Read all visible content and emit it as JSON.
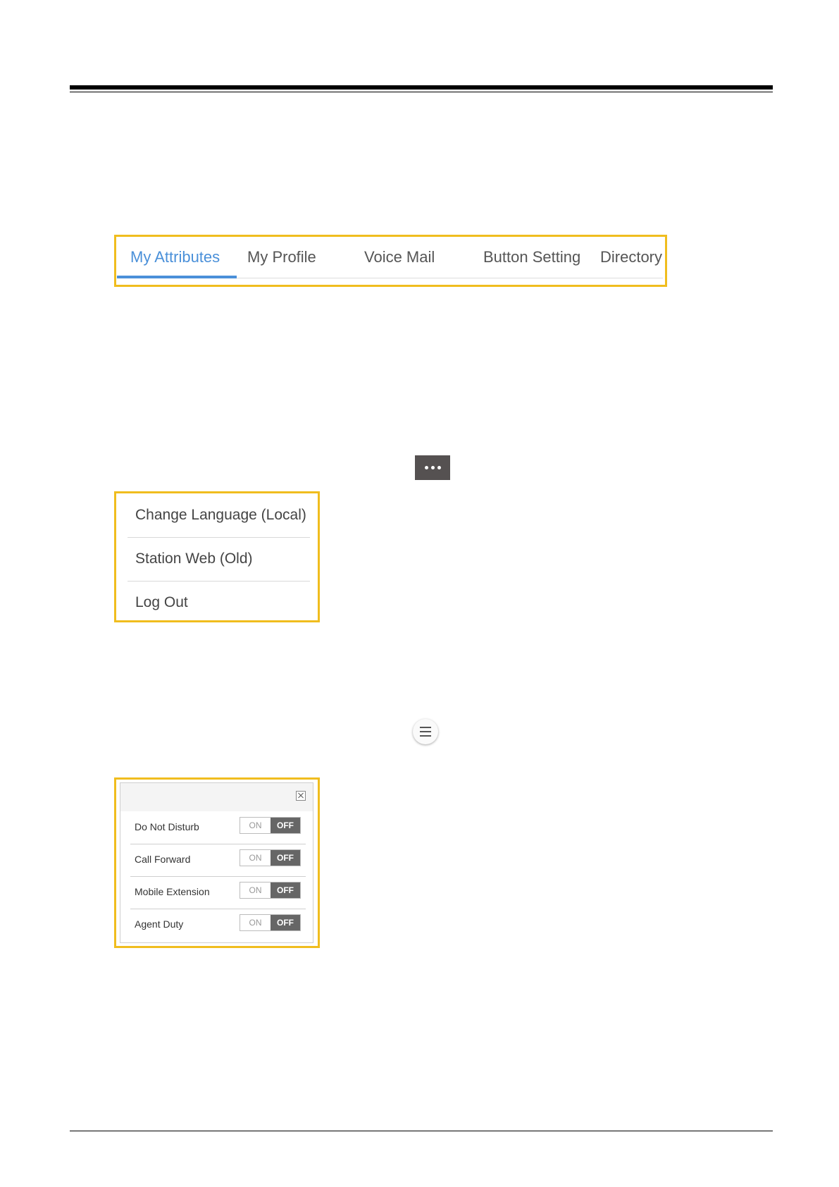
{
  "tabs": [
    {
      "label": "My Attributes",
      "active": true
    },
    {
      "label": "My Profile",
      "active": false
    },
    {
      "label": "Voice Mail",
      "active": false
    },
    {
      "label": "Button Setting",
      "active": false
    },
    {
      "label": "Directory",
      "active": false
    }
  ],
  "more_button": {
    "icon": "ellipsis-icon"
  },
  "menu": {
    "items": [
      "Change Language (Local)",
      "Station Web (Old)",
      "Log Out"
    ]
  },
  "hamburger": {
    "icon": "hamburger-menu-icon"
  },
  "quick_settings": {
    "close_icon": "close-icon",
    "rows": [
      {
        "label": "Do Not Disturb",
        "on_label": "ON",
        "off_label": "OFF",
        "state": "OFF"
      },
      {
        "label": "Call Forward",
        "on_label": "ON",
        "off_label": "OFF",
        "state": "OFF"
      },
      {
        "label": "Mobile Extension",
        "on_label": "ON",
        "off_label": "OFF",
        "state": "OFF"
      },
      {
        "label": "Agent Duty",
        "on_label": "ON",
        "off_label": "OFF",
        "state": "OFF"
      }
    ]
  },
  "colors": {
    "highlight": "#f0bd1e",
    "accent": "#4a90d9",
    "toggle_off": "#666666",
    "menu_button": "#555151"
  }
}
